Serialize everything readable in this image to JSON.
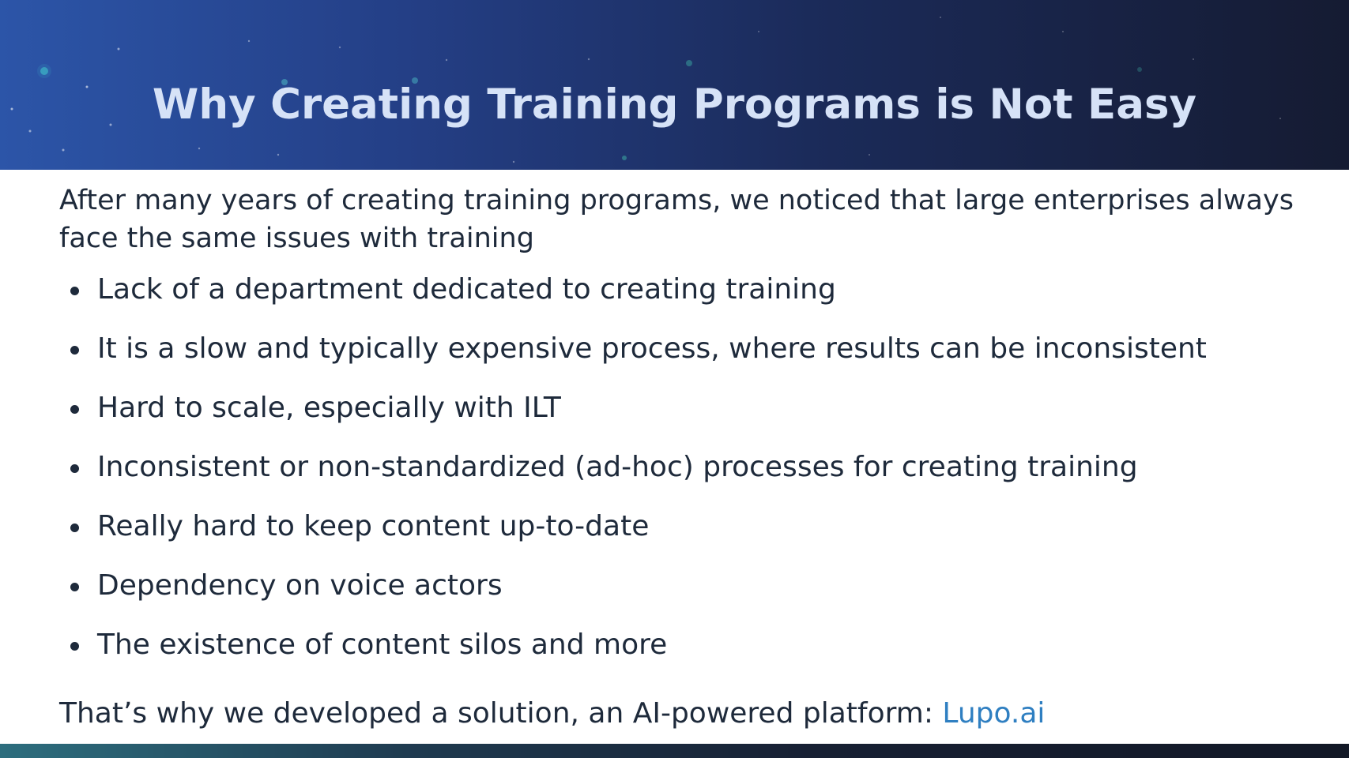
{
  "slide": {
    "title": "Why Creating Training Programs is Not Easy",
    "intro": "After many years of creating training programs, we noticed that large enterprises always face the same issues with training",
    "bullets": [
      "Lack of a department dedicated to creating training",
      "It is a slow and typically expensive process, where results can be inconsistent",
      "Hard to scale, especially with ILT",
      "Inconsistent or non-standardized (ad-hoc) processes for creating training",
      "Really hard to keep content up-to-date",
      "Dependency on voice actors",
      "The existence of content silos and more"
    ],
    "closing_text": "That’s why we developed a solution, an AI-powered platform: ",
    "closing_link": "Lupo.ai"
  },
  "colors": {
    "header_start": "#2c55a8",
    "header_end": "#151b32",
    "title": "#d6e2f7",
    "body_text": "#1e2a3b",
    "link": "#2f7fc1"
  },
  "icons": {
    "bullet": "bullet-dot-icon"
  }
}
